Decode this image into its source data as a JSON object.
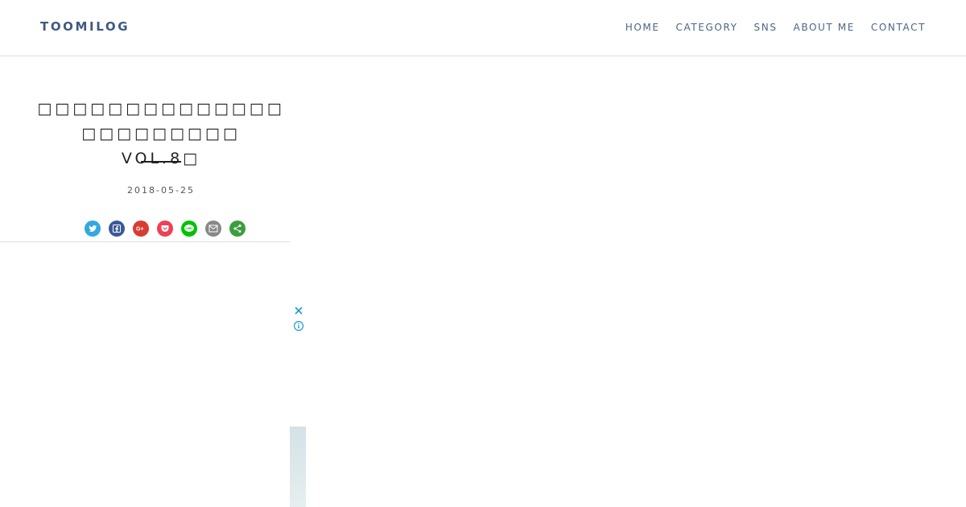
{
  "header": {
    "logo": "TOOMILOG",
    "nav": [
      {
        "label": "HOME"
      },
      {
        "label": "CATEGORY"
      },
      {
        "label": "SNS"
      },
      {
        "label": "ABOUT ME"
      },
      {
        "label": "CONTACT"
      }
    ]
  },
  "article": {
    "title_line1": "□□□□□□□□□□□□□□ □□□□□□□□□",
    "title_line2": "VOL.8□",
    "date": "2018-05-25"
  },
  "share": [
    {
      "icon": "twitter-icon",
      "color": "#32a8e0"
    },
    {
      "icon": "facebook-icon",
      "color": "#3b5998"
    },
    {
      "icon": "google-plus-icon",
      "color": "#d73d32"
    },
    {
      "icon": "pocket-icon",
      "color": "#ee4056"
    },
    {
      "icon": "line-icon",
      "color": "#00c300"
    },
    {
      "icon": "email-icon",
      "color": "#888888"
    },
    {
      "icon": "more-icon",
      "color": "#3e9d3e"
    }
  ],
  "ad": {
    "close_icon": "close-icon",
    "info_icon": "info-icon",
    "accent": "#1a9cd8"
  }
}
